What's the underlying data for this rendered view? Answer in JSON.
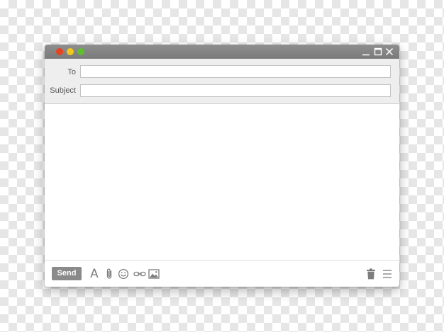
{
  "compose": {
    "to_label": "To",
    "to_value": "",
    "subject_label": "Subject",
    "subject_value": "",
    "body_value": ""
  },
  "toolbar": {
    "send_label": "Send",
    "font_glyph": "A"
  },
  "icons": {
    "traffic_lights": [
      "close-dot-icon",
      "minimize-dot-icon",
      "zoom-dot-icon"
    ],
    "window_controls": [
      "minimize-icon",
      "maximize-icon",
      "close-icon"
    ],
    "toolbar": [
      "font-icon",
      "paperclip-icon",
      "emoji-icon",
      "link-icon",
      "image-icon",
      "trash-icon",
      "menu-icon"
    ]
  },
  "colors": {
    "traffic_red": "#e8421e",
    "traffic_yellow": "#f2c81b",
    "traffic_green": "#5ec02e",
    "titlebar": "#828282",
    "send_button": "#8a8a8a",
    "icon_gray": "#7d7d7d"
  }
}
